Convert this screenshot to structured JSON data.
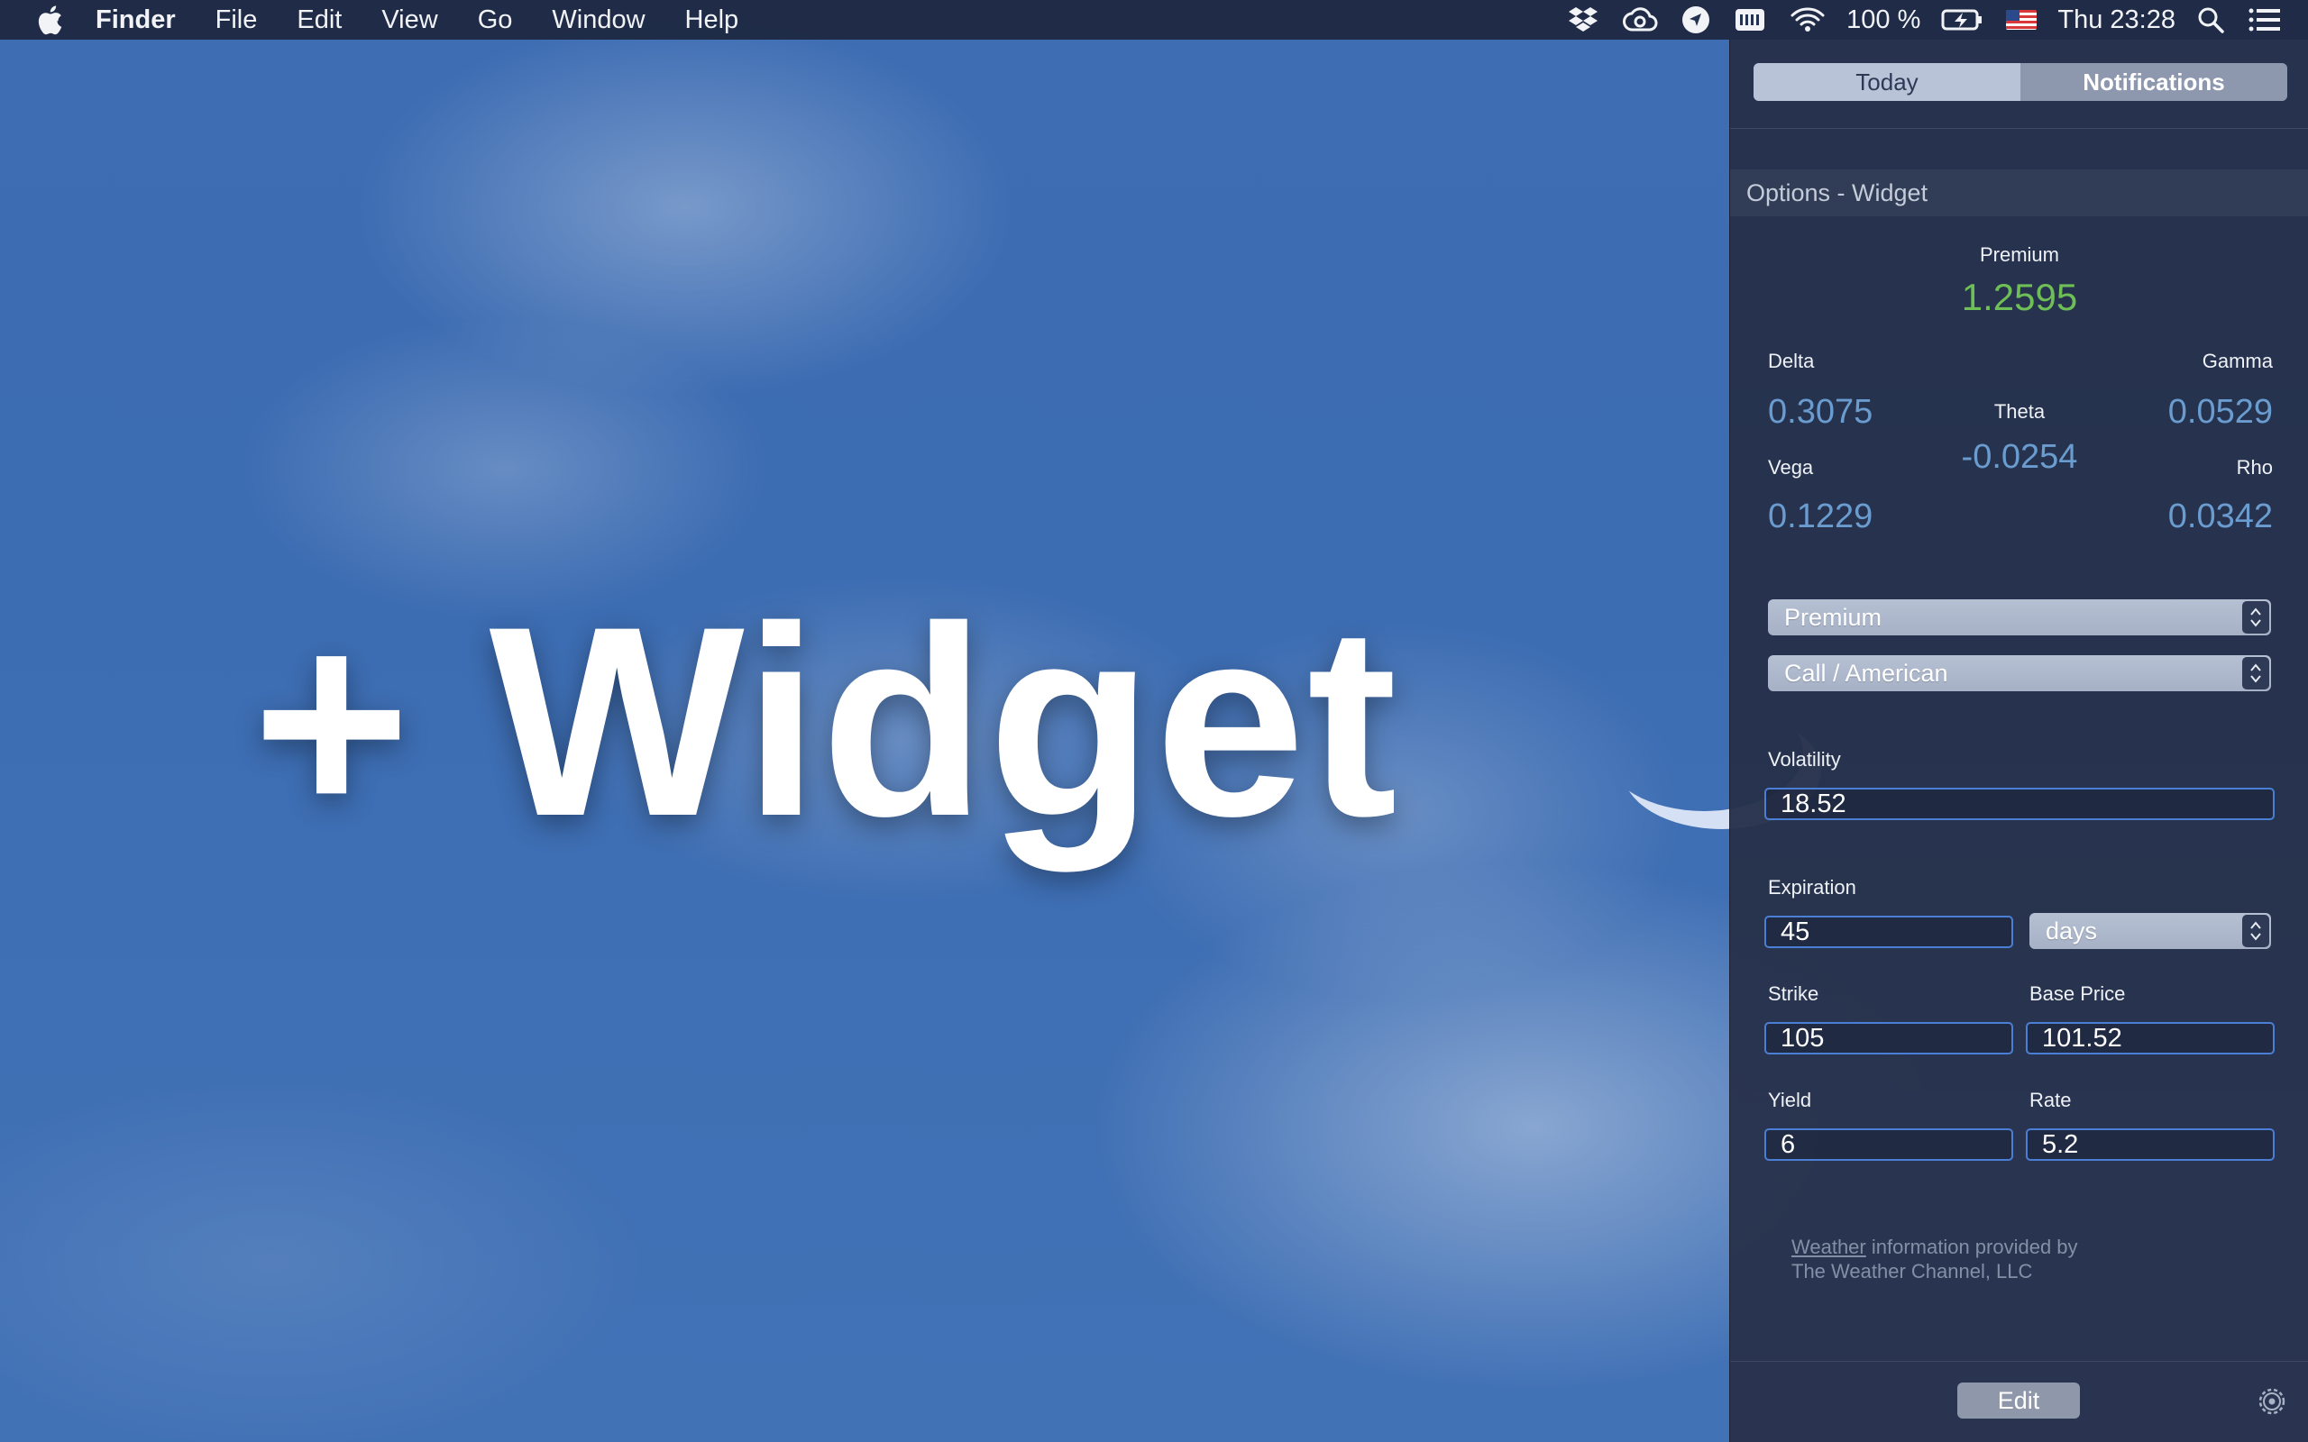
{
  "menubar": {
    "app_name": "Finder",
    "menus": [
      "File",
      "Edit",
      "View",
      "Go",
      "Window",
      "Help"
    ],
    "battery_percent": "100 %",
    "clock": "Thu 23:28",
    "status_icons": [
      "dropbox-icon",
      "creative-cloud-icon",
      "location-icon",
      "keyboard-icon",
      "wifi-icon",
      "battery-charging-icon",
      "flag-us-icon",
      "spotlight-search-icon",
      "notification-center-icon"
    ]
  },
  "desktop": {
    "hero_text": "+ Widget"
  },
  "notification_center": {
    "tabs": {
      "today": "Today",
      "notifications": "Notifications"
    },
    "widget": {
      "title": "Options - Widget",
      "premium_label": "Premium",
      "premium_value": "1.2595",
      "greeks": {
        "delta_label": "Delta",
        "delta_value": "0.3075",
        "gamma_label": "Gamma",
        "gamma_value": "0.0529",
        "theta_label": "Theta",
        "theta_value": "-0.0254",
        "vega_label": "Vega",
        "vega_value": "0.1229",
        "rho_label": "Rho",
        "rho_value": "0.0342"
      },
      "calc_select": "Premium",
      "type_select": "Call / American",
      "volatility_label": "Volatility",
      "volatility_value": "18.52",
      "expiration_label": "Expiration",
      "expiration_value": "45",
      "expiration_unit": "days",
      "strike_label": "Strike",
      "strike_value": "105",
      "base_price_label": "Base Price",
      "base_price_value": "101.52",
      "yield_label": "Yield",
      "yield_value": "6",
      "rate_label": "Rate",
      "rate_value": "5.2"
    },
    "weather_note": {
      "link": "Weather",
      "line1_rest": " information provided by",
      "line2": "The Weather Channel, LLC"
    },
    "edit_label": "Edit"
  },
  "colors": {
    "premium_value": "#6fbf57",
    "greek_value": "#6a9cd0",
    "input_border": "#4b7fd6"
  }
}
